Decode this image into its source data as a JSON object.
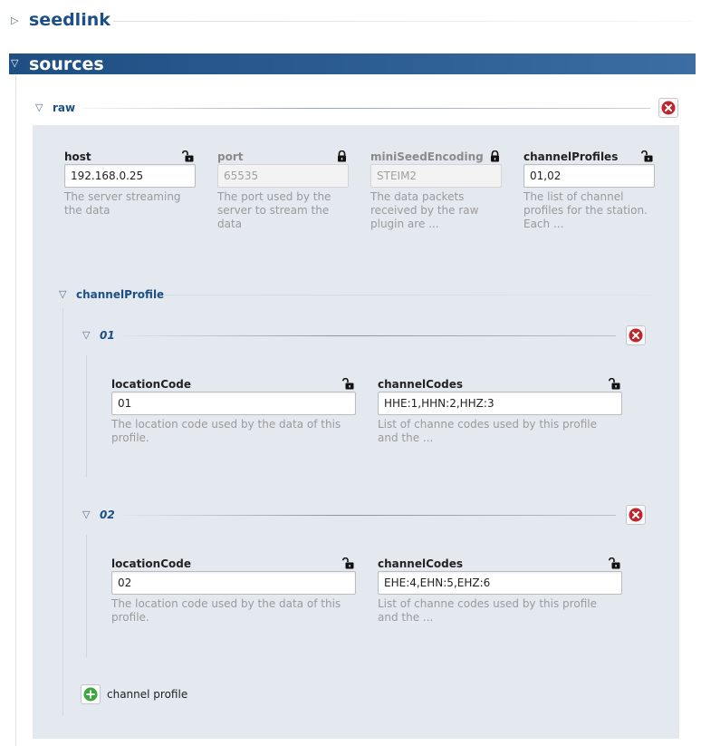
{
  "seedlink": {
    "title": "seedlink"
  },
  "sources": {
    "title": "sources"
  },
  "raw": {
    "title": "raw",
    "fields": [
      {
        "label": "host",
        "value": "192.168.0.25",
        "description": "The server streaming the data",
        "locked": false,
        "enabled": true
      },
      {
        "label": "port",
        "value": "65535",
        "description": "The port used by the server to stream the data",
        "locked": true,
        "enabled": false
      },
      {
        "label": "miniSeedEncoding",
        "value": "STEIM2",
        "description": "The data packets received by the raw plugin are ...",
        "locked": true,
        "enabled": false
      },
      {
        "label": "channelProfiles",
        "value": "01,02",
        "description": "The list of channel profiles for the station. Each ...",
        "locked": false,
        "enabled": true
      }
    ],
    "channelProfile": {
      "title": "channelProfile",
      "profiles": [
        {
          "name": "01",
          "locationCode": {
            "label": "locationCode",
            "value": "01",
            "description": "The location code used by the data of this profile."
          },
          "channelCodes": {
            "label": "channelCodes",
            "value": "HHE:1,HHN:2,HHZ:3",
            "description": "List of channe codes used by this profile and the ..."
          }
        },
        {
          "name": "02",
          "locationCode": {
            "label": "locationCode",
            "value": "02",
            "description": "The location code used by the data of this profile."
          },
          "channelCodes": {
            "label": "channelCodes",
            "value": "EHE:4,EHN:5,EHZ:6",
            "description": "List of channe codes used by this profile and the ..."
          }
        }
      ],
      "add_label": "channel profile"
    }
  },
  "colors": {
    "header_bar": "#2b5a8f",
    "section_title": "#1d4f86",
    "panel_bg": "#e4e9ef",
    "delete_red": "#c0262b",
    "add_green": "#3aa83a"
  },
  "icons": {
    "expand": "triangle-right-icon",
    "collapse": "triangle-down-icon",
    "lock_closed": "lock-closed-icon",
    "lock_open": "lock-open-icon",
    "delete": "delete-icon",
    "add": "add-icon"
  }
}
